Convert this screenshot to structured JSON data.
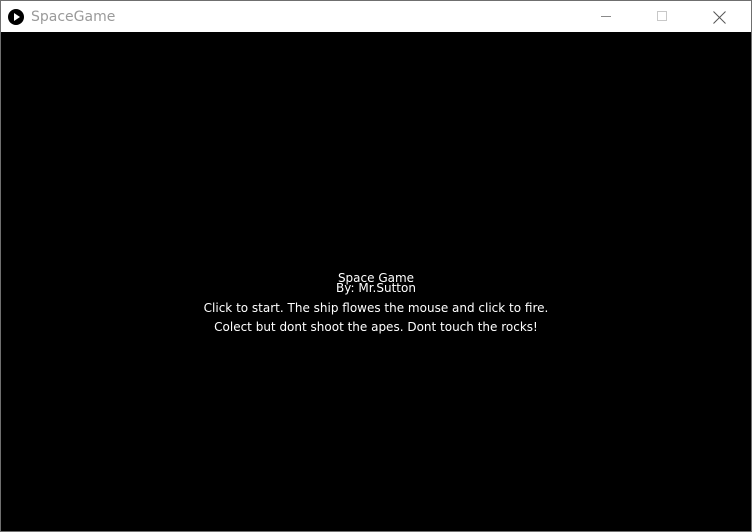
{
  "window": {
    "title": "SpaceGame",
    "icon": "play-circle-icon",
    "controls": [
      "minimize-icon",
      "maximize-icon",
      "close-icon"
    ]
  },
  "game": {
    "title": "Space Game",
    "author": "By: Mr.Sutton",
    "instructions_line1": "Click to start. The ship flowes the mouse and click to fire.",
    "instructions_line2": "Colect but dont shoot the apes. Dont touch the rocks!",
    "background_color": "#000000",
    "text_color": "#ffffff"
  }
}
